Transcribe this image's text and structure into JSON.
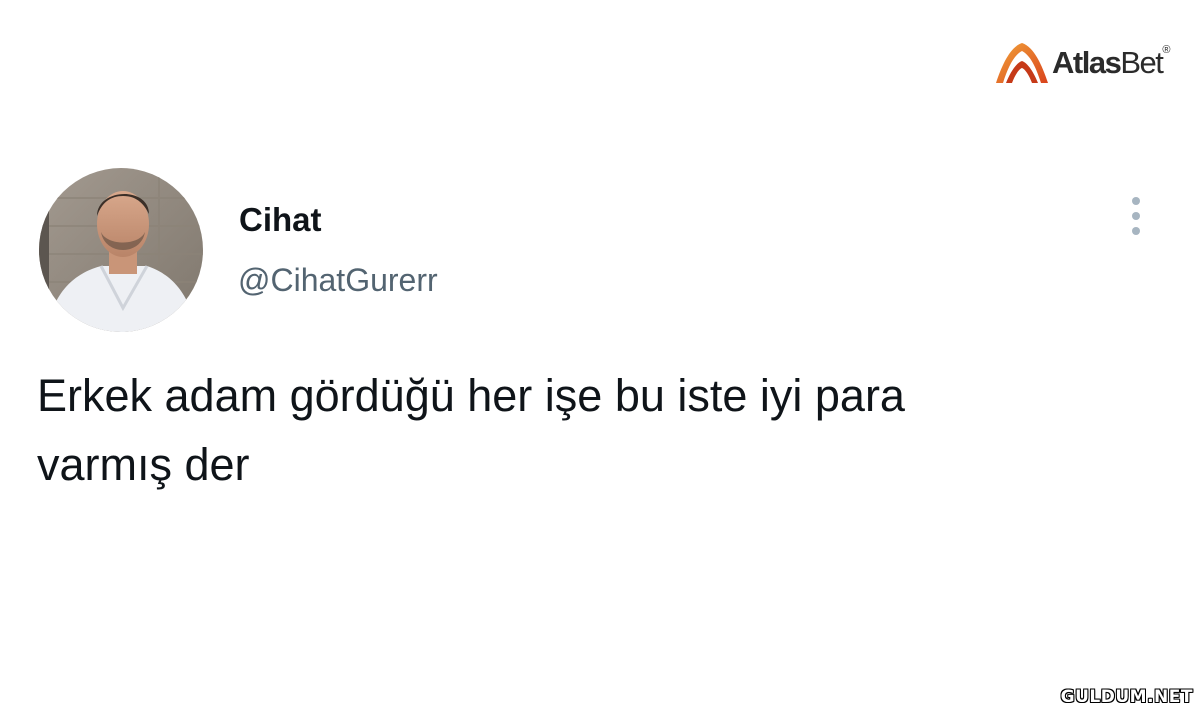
{
  "brand": {
    "logo_text_bold": "Atlas",
    "logo_text_light": "Bet",
    "logo_mark": "®",
    "logo_icon": "atlasbet-logo-icon",
    "accent_color": "#e05a1f"
  },
  "tweet": {
    "author": {
      "display_name": "Cihat",
      "handle": "@CihatGurerr",
      "avatar_icon": "profile-photo"
    },
    "more_icon": "vertical-ellipsis-icon",
    "text": "Erkek adam gördüğü her işe bu iste iyi para\nvarmış der"
  },
  "watermark": {
    "text": "GULDUM.NET"
  }
}
